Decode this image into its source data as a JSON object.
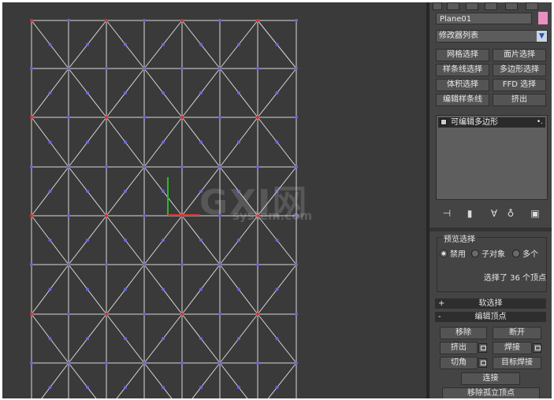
{
  "watermark": {
    "main": "GXI网",
    "sub": "system.com"
  },
  "panel": {
    "object_name": "Plane01",
    "object_color": "#e890c0",
    "modifier_list": "修改器列表",
    "modifier_buttons": [
      "网格选择",
      "面片选择",
      "样条线选择",
      "多边形选择",
      "体积选择",
      "FFD 选择",
      "编辑样条线",
      "挤出"
    ],
    "stack_item": "可编辑多边形",
    "stack_tools": [
      "pin-stack-icon",
      "show-end-result-icon",
      "make-unique-icon",
      "remove-modifier-icon",
      "configure-modifier-sets-icon"
    ],
    "preview": {
      "title": "预览选择",
      "options": [
        "禁用",
        "子对象",
        "多个"
      ],
      "selected": "禁用",
      "status": "选择了 36 个顶点"
    },
    "rollouts": {
      "soft_select": "软选择",
      "edit_vertices": "编辑顶点"
    },
    "edit_buttons": {
      "remove": "移除",
      "break": "断开",
      "extrude": "挤出",
      "weld": "焊接",
      "chamfer": "切角",
      "target_weld": "目标焊接",
      "connect": "连接",
      "remove_isolated": "移除孤立顶点"
    }
  },
  "viewport": {
    "grid_line_color": "#d8d8d8",
    "vertex_red": "#e03030",
    "vertex_blue": "#6868e8",
    "gizmo_green": "#20c020",
    "gizmo_red": "#e03030"
  }
}
